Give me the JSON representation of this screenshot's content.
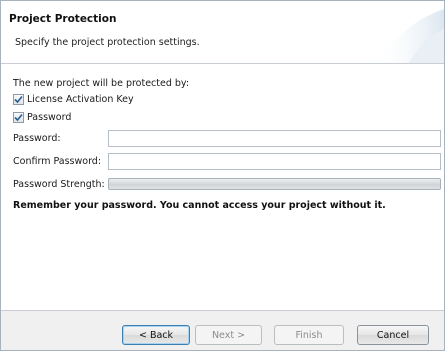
{
  "header": {
    "title": "Project Protection",
    "description": "Specify the project protection settings."
  },
  "content": {
    "intro": "The new project will be protected by:",
    "options": [
      {
        "label": "License Activation Key",
        "checked": true
      },
      {
        "label": "Password",
        "checked": true
      }
    ],
    "fields": {
      "password_label": "Password:",
      "password_value": "",
      "confirm_label": "Confirm Password:",
      "confirm_value": "",
      "strength_label": "Password Strength:",
      "strength_level": 0
    },
    "warning": "Remember your password. You cannot access your project without it."
  },
  "footer": {
    "back_label": "< Back",
    "next_label": "Next >",
    "finish_label": "Finish",
    "cancel_label": "Cancel"
  },
  "icons": {
    "checkmark": "checkmark-icon"
  },
  "colors": {
    "checkmark": "#2b5f8e",
    "default_button_border": "#3c7fb1",
    "header_graphic": "#dbe6ef"
  }
}
